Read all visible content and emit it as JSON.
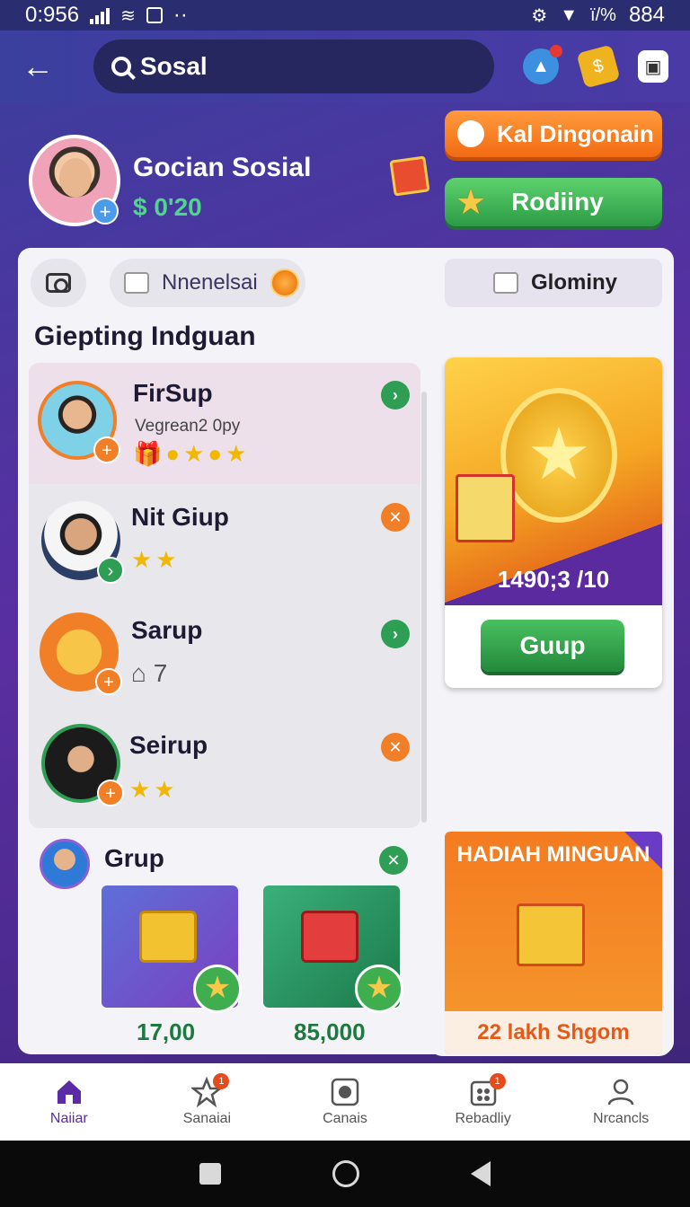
{
  "status_bar": {
    "time": "0:956",
    "battery": "884",
    "signal_text": "ï/%"
  },
  "header": {
    "search_value": "Sosal"
  },
  "profile": {
    "name": "Gocian Sosial",
    "balance": "$ 0'20"
  },
  "actions": {
    "orange_button": "Kal Dingonain",
    "green_button": "Rodiiny"
  },
  "filters": {
    "pill1": "Nnenelsai",
    "pill2": "Glominy"
  },
  "section_title": "Giepting Indguan",
  "groups": [
    {
      "name": "FirSup",
      "subtitle": "Vegrean2 0py",
      "button": "green"
    },
    {
      "name": "Nit Giup",
      "stars": "★★",
      "button": "orange"
    },
    {
      "name": "Sarup",
      "subtitle": "⌂ 7",
      "button": "green"
    },
    {
      "name": "Seirup",
      "stars": "★★",
      "button": "orange"
    }
  ],
  "grup_card": {
    "name": "Grup",
    "tiles": [
      {
        "value": "17,00"
      },
      {
        "value": "85,000"
      }
    ]
  },
  "promo_card": {
    "value": "1490;3 /10",
    "button": "Guup"
  },
  "weekly_card": {
    "title": "HADIAH MINGUAN",
    "footer": "22 lakh Shgom"
  },
  "bottom_nav": [
    {
      "label": "Naiiar",
      "icon": "home-icon",
      "active": true
    },
    {
      "label": "Sanaiai",
      "icon": "star-icon",
      "badge": "1"
    },
    {
      "label": "Canais",
      "icon": "gallery-icon"
    },
    {
      "label": "Rebadliy",
      "icon": "calendar-icon",
      "badge": "1"
    },
    {
      "label": "Nrcancls",
      "icon": "person-icon"
    }
  ],
  "colors": {
    "accent_purple": "#5b2aa6",
    "green": "#2f9e55",
    "orange": "#f07f28"
  }
}
